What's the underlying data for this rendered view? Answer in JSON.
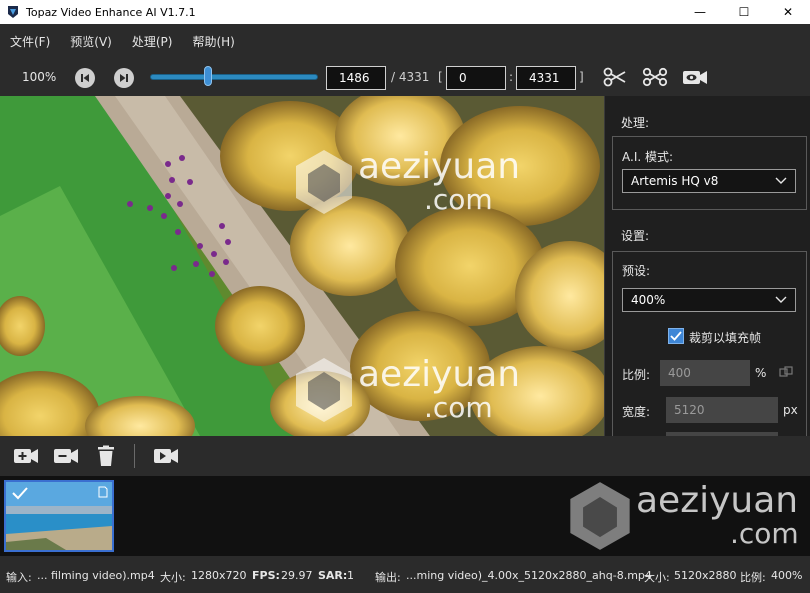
{
  "window": {
    "title": "Topaz Video Enhance AI V1.7.1",
    "controls": {
      "minimize": "—",
      "maximize": "☐",
      "close": "✕"
    }
  },
  "menu": [
    "文件(F)",
    "预览(V)",
    "处理(P)",
    "帮助(H)"
  ],
  "toolbar": {
    "zoom": "100%",
    "current_frame": "1486",
    "total_frames": "/ 4331",
    "range_open": "[",
    "range_start": "0",
    "range_colon": ":",
    "range_end": "4331",
    "range_close": "]",
    "slider_fraction": 0.343,
    "icons": [
      "skip-back-icon",
      "skip-forward-icon",
      "scissors-icon",
      "split-scissors-icon",
      "camera-eye-icon"
    ]
  },
  "watermark": {
    "brand": "aeziyuan",
    "domain": ".com"
  },
  "panel": {
    "process_label": "处理:",
    "ai_mode_label": "A.I. 模式:",
    "ai_mode_value": "Artemis HQ v8",
    "settings_label": "设置:",
    "preset_label": "预设:",
    "preset_value": "400%",
    "crop_label": "裁剪以填充帧",
    "crop_checked": true,
    "scale_label": "比例:",
    "scale_value": "400",
    "scale_unit": "%",
    "width_label": "宽度:",
    "width_value": "5120",
    "width_unit": "px"
  },
  "controls": [
    "add-video-icon",
    "remove-video-icon",
    "trash-icon",
    "play-video-icon"
  ],
  "status": {
    "input_label": "输入:",
    "input_value": "... filming video).mp4",
    "in_size_label": "大小:",
    "in_size_value": "1280x720",
    "fps_label": "FPS:",
    "fps_value": "29.97",
    "sar_label": "SAR:",
    "sar_value": "1",
    "output_label": "输出:",
    "output_value": "...ming video)_4.00x_5120x2880_ahq-8.mp4",
    "out_size_label": "大小:",
    "out_size_value": "5120x2880",
    "ratio_label": "比例:",
    "ratio_value": "400%"
  },
  "colors": {
    "accent": "#3e86d6",
    "background": "#1e1e1e",
    "toolbar": "#2b2b2b"
  }
}
